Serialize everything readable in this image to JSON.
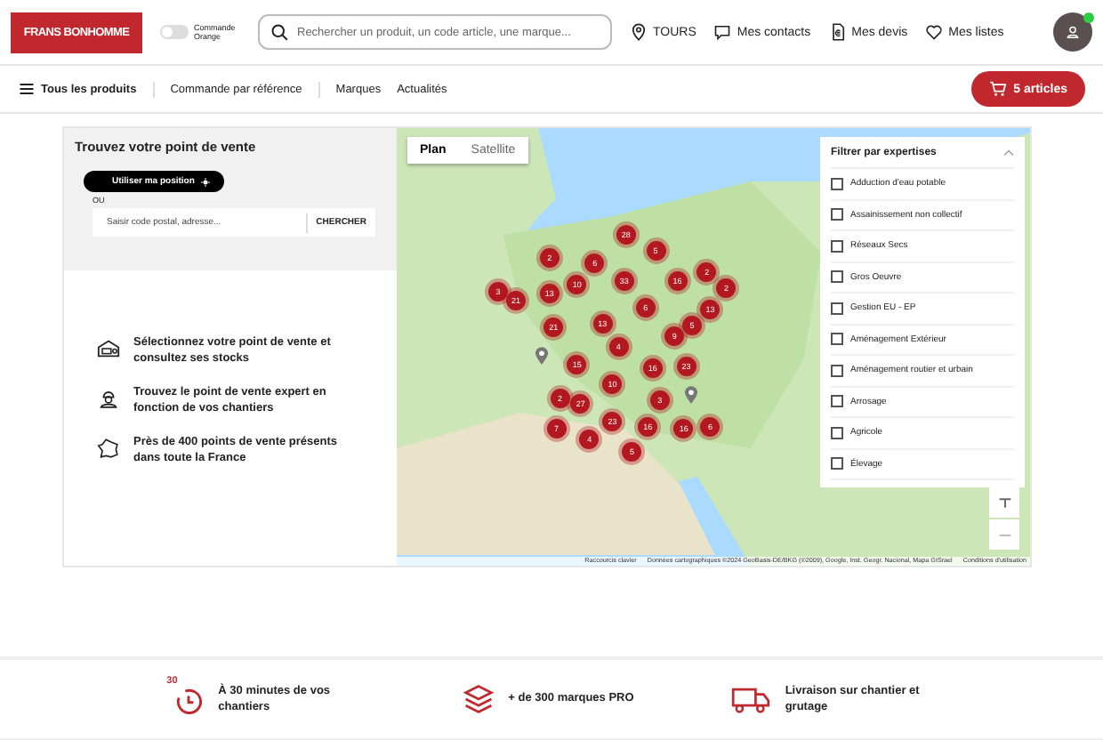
{
  "header": {
    "logo": "FRANS BONHOMME",
    "toggle": {
      "label": "Commande Orange",
      "on": false
    },
    "search": {
      "placeholder": "Rechercher un produit, un code article, une marque..."
    },
    "location": "TOURS",
    "links": [
      {
        "kind": "contacts",
        "label": "Mes contacts"
      },
      {
        "kind": "quotes",
        "label": "Mes devis"
      },
      {
        "kind": "lists",
        "label": "Mes listes"
      }
    ],
    "avatar": {
      "online": true
    }
  },
  "nav": {
    "menu": "Tous les produits",
    "links": [
      "Commande par référence",
      "Marques",
      "Actualités"
    ],
    "cart": "5 articles"
  },
  "finder": {
    "title": "Trouvez votre point de vente",
    "position_button": "Utiliser ma position",
    "or": "OU",
    "postal": {
      "placeholder": "Saisir code postal, adresse..."
    },
    "search_button": "CHERCHER"
  },
  "benefits": [
    {
      "kind": "store",
      "text": "Sélectionnez votre point de vente et consultez ses stocks"
    },
    {
      "kind": "expert",
      "text": "Trouvez le point de vente expert en fonction de vos chantiers"
    },
    {
      "kind": "france",
      "text": "Près de 400 points de vente présents dans toute la France"
    }
  ],
  "map": {
    "tabs": [
      {
        "label": "Plan",
        "selected": true
      },
      {
        "label": "Satellite",
        "selected": false
      }
    ],
    "clusters": [
      "28",
      "5",
      "2",
      "6",
      "33",
      "16",
      "2",
      "2",
      "3",
      "21",
      "13",
      "10",
      "6",
      "13",
      "21",
      "13",
      "5",
      "9",
      "4",
      "15",
      "16",
      "23",
      "10",
      "2",
      "27",
      "3",
      "7",
      "4",
      "23",
      "16",
      "16",
      "6",
      "5"
    ],
    "filter": {
      "title": "Filtrer par expertises",
      "expanded": true,
      "options": [
        {
          "label": "Adduction d'eau potable",
          "checked": false
        },
        {
          "label": "Assainissement non collectif",
          "checked": false
        },
        {
          "label": "Réseaux Secs",
          "checked": false
        },
        {
          "label": "Gros Oeuvre",
          "checked": false
        },
        {
          "label": "Gestion EU - EP",
          "checked": false
        },
        {
          "label": "Aménagement Extérieur",
          "checked": false
        },
        {
          "label": "Aménagement routier et urbain",
          "checked": false
        },
        {
          "label": "Arrosage",
          "checked": false
        },
        {
          "label": "Agricole",
          "checked": false
        },
        {
          "label": "Élevage",
          "checked": false
        }
      ]
    },
    "attribution": [
      "Raccourcis clavier",
      "Données cartographiques ©2024 GeoBasis-DE/BKG (©2009), Google, Inst. Geogr. Nacional, Mapa GISrael",
      "Conditions d'utilisation"
    ]
  },
  "features": [
    {
      "kind": "clock",
      "badge": "30",
      "text": "À 30 minutes de vos chantiers"
    },
    {
      "kind": "layers",
      "text": "+ de 300 marques PRO"
    },
    {
      "kind": "truck",
      "text": "Livraison sur chantier et grutage"
    }
  ]
}
